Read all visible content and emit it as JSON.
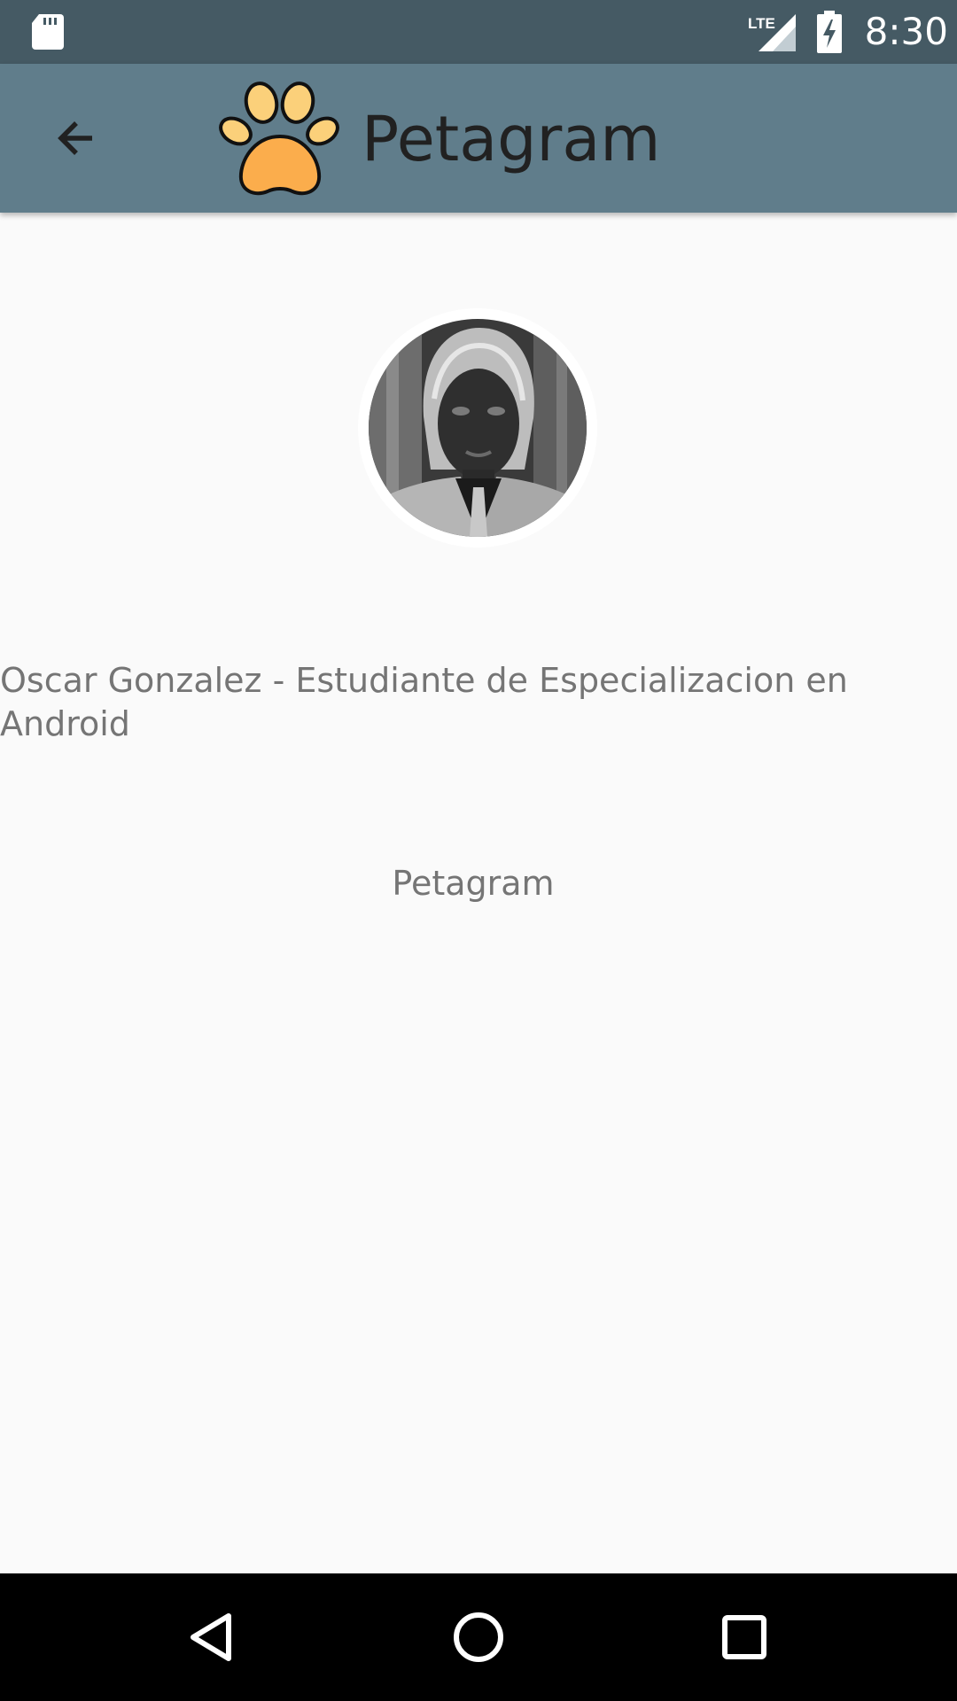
{
  "status_bar": {
    "time": "8:30",
    "network_label": "LTE",
    "icons": [
      "sd-card-icon",
      "lte-signal-icon",
      "battery-charging-icon"
    ]
  },
  "toolbar": {
    "title": "Petagram",
    "back_icon": "arrow-back-icon",
    "logo_icon": "paw-icon",
    "colors": {
      "background": "#607d8b",
      "title": "#212121",
      "paw": "#fbad4c"
    }
  },
  "profile": {
    "avatar_icon": "profile-photo",
    "bio": "Oscar Gonzalez - Estudiante de Especializacion en Android",
    "app_name": "Petagram"
  },
  "nav_bar": {
    "items": [
      "back-triangle-icon",
      "home-circle-icon",
      "recents-square-icon"
    ]
  },
  "colors": {
    "status_bar": "#455a64",
    "background": "#fafafa",
    "text_secondary": "#757575"
  }
}
